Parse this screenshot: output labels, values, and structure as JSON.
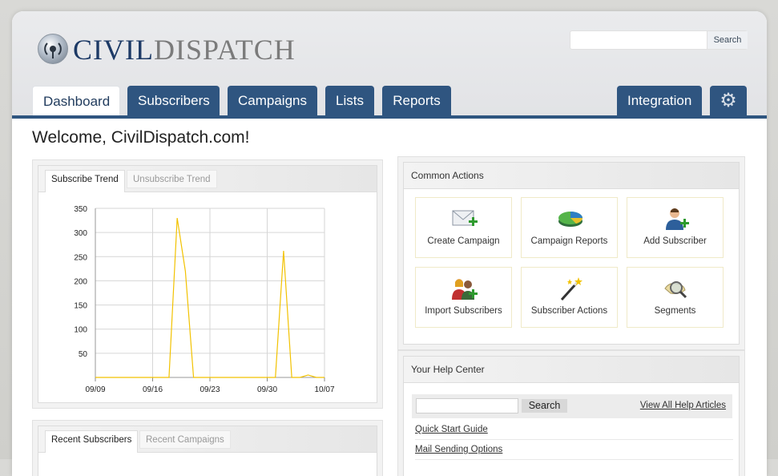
{
  "logo": {
    "part1": "CIVIL",
    "part2": "DISPATCH"
  },
  "search": {
    "button": "Search",
    "placeholder": ""
  },
  "tabs": [
    {
      "label": "Dashboard",
      "active": true
    },
    {
      "label": "Subscribers",
      "active": false
    },
    {
      "label": "Campaigns",
      "active": false
    },
    {
      "label": "Lists",
      "active": false
    },
    {
      "label": "Reports",
      "active": false
    },
    {
      "label": "Integration",
      "active": false
    }
  ],
  "settings_icon": "gear-icon",
  "welcome": "Welcome, CivilDispatch.com!",
  "trend_panel": {
    "tabs": [
      "Subscribe Trend",
      "Unsubscribe Trend"
    ]
  },
  "chart_data": {
    "type": "line",
    "x": [
      "09/09",
      "09/10",
      "09/11",
      "09/12",
      "09/13",
      "09/14",
      "09/15",
      "09/16",
      "09/17",
      "09/18",
      "09/19",
      "09/20",
      "09/21",
      "09/22",
      "09/23",
      "09/24",
      "09/25",
      "09/26",
      "09/27",
      "09/28",
      "09/29",
      "09/30",
      "10/01",
      "10/02",
      "10/03",
      "10/04",
      "10/05",
      "10/06",
      "10/07"
    ],
    "series": [
      {
        "values": [
          0,
          0,
          0,
          0,
          0,
          0,
          0,
          0,
          0,
          0,
          330,
          220,
          0,
          0,
          0,
          0,
          0,
          0,
          0,
          0,
          0,
          0,
          0,
          262,
          0,
          0,
          5,
          0,
          0
        ]
      }
    ],
    "xticks": [
      "09/09",
      "09/16",
      "09/23",
      "09/30",
      "10/07"
    ],
    "yticks": [
      50,
      100,
      150,
      200,
      250,
      300,
      350
    ],
    "ylim": [
      0,
      350
    ],
    "grid": true,
    "color": "#f2c200"
  },
  "common_actions": {
    "title": "Common Actions",
    "items": [
      {
        "label": "Create Campaign",
        "icon": "envelope-add-icon"
      },
      {
        "label": "Campaign Reports",
        "icon": "pie-chart-icon"
      },
      {
        "label": "Add Subscriber",
        "icon": "user-add-icon"
      },
      {
        "label": "Import Subscribers",
        "icon": "users-add-icon"
      },
      {
        "label": "Subscriber Actions",
        "icon": "magic-wand-icon"
      },
      {
        "label": "Segments",
        "icon": "magnifier-icon"
      }
    ]
  },
  "help_center": {
    "title": "Your Help Center",
    "search_button": "Search",
    "view_all": "View All Help Articles",
    "links": [
      "Quick Start Guide",
      "Mail Sending Options"
    ]
  },
  "recent_panel": {
    "tabs": [
      "Recent Subscribers",
      "Recent Campaigns"
    ]
  }
}
